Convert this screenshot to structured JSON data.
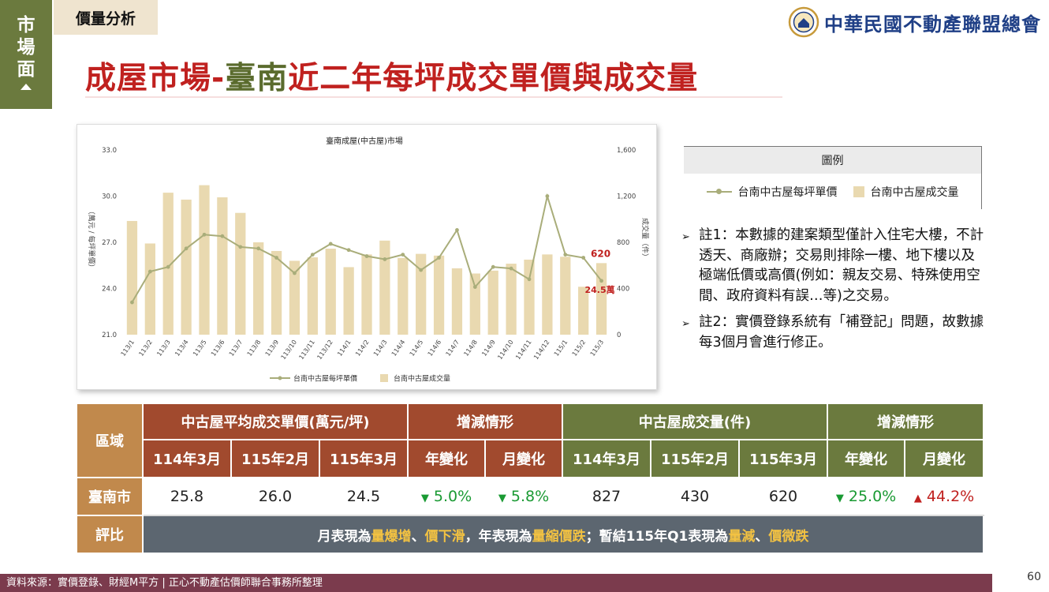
{
  "side_tab": {
    "chars": [
      "市",
      "場",
      "面"
    ]
  },
  "section_tag": "價量分析",
  "org_name": "中華民國不動產聯盟總會",
  "title": {
    "part1": "成屋市場-",
    "part2": "臺南",
    "part3": "近二年每坪成交單價與成交量"
  },
  "legend": {
    "header": "圖例",
    "line_label": "台南中古屋每坪單價",
    "bar_label": "台南中古屋成交量"
  },
  "notes": [
    "註1：本數據的建案類型僅計入住宅大樓，不計透天、商廠辦；交易則排除一樓、地下樓以及極端低價或高價(例如：親友交易、特殊使用空間、政府資料有誤…等)之交易。",
    "註2：實價登錄系統有「補登記」問題，故數據每3個月會進行修正。"
  ],
  "table": {
    "region_header": "區域",
    "price_header": "中古屋平均成交單價(萬元/坪)",
    "price_change_header": "增減情形",
    "volume_header": "中古屋成交量(件)",
    "volume_change_header": "增減情形",
    "period_cols": [
      "114年3月",
      "115年2月",
      "115年3月"
    ],
    "change_cols": [
      "年變化",
      "月變化"
    ],
    "row": {
      "region": "臺南市",
      "prices": [
        "25.8",
        "26.0",
        "24.5"
      ],
      "price_changes": [
        {
          "arrow": "▼",
          "value": "5.0%"
        },
        {
          "arrow": "▼",
          "value": "5.8%"
        }
      ],
      "volumes": [
        "827",
        "430",
        "620"
      ],
      "volume_changes": [
        {
          "arrow": "▼",
          "value": "25.0%"
        },
        {
          "arrow": "▲",
          "value": "44.2%"
        }
      ]
    },
    "summary_label": "評比",
    "summary": {
      "t1": "月表現為",
      "h1": "量爆增",
      "t2": "、",
      "h2": "價下滑",
      "t3": "，年表現為",
      "h3": "量縮價跌",
      "t4": "；暫結115年Q1表現為",
      "h4": "量減",
      "t5": "、",
      "h5": "價微跌"
    }
  },
  "footer": "資料來源：實價登錄、財經M平方 | 正心不動產估價師聯合事務所整理",
  "page_number": "60",
  "colors": {
    "bar": "#e9d9b0",
    "line": "#a9ad7a",
    "annotation": "#c0211f",
    "olive": "#6b7a3e",
    "brick": "#a14a2e",
    "tan": "#c1894c"
  },
  "chart_data": {
    "type": "bar",
    "title": "臺南成屋(中古屋)市場",
    "categories": [
      "113/1",
      "113/2",
      "113/3",
      "113/4",
      "113/5",
      "113/6",
      "113/7",
      "113/8",
      "113/9",
      "113/10",
      "113/11",
      "113/12",
      "114/1",
      "114/2",
      "114/3",
      "114/4",
      "114/5",
      "114/6",
      "114/7",
      "114/8",
      "114/9",
      "114/10",
      "114/11",
      "114/12",
      "115/1",
      "115/2",
      "115/3"
    ],
    "series": [
      {
        "name": "台南中古屋每坪單價",
        "kind": "line",
        "axis": "left",
        "values": [
          23.1,
          25.1,
          25.4,
          26.6,
          27.5,
          27.4,
          26.7,
          26.6,
          26.0,
          25.0,
          26.2,
          26.9,
          26.5,
          26.1,
          25.9,
          26.2,
          25.2,
          26.0,
          27.8,
          24.1,
          25.4,
          25.3,
          24.6,
          30.0,
          26.2,
          26.0,
          24.5
        ]
      },
      {
        "name": "台南中古屋成交量",
        "kind": "bar",
        "axis": "right",
        "values": [
          985,
          790,
          1230,
          1170,
          1295,
          1190,
          1055,
          800,
          725,
          640,
          670,
          745,
          585,
          695,
          815,
          665,
          700,
          685,
          575,
          530,
          555,
          615,
          650,
          695,
          675,
          415,
          620
        ]
      }
    ],
    "left_axis": {
      "label": "（萬元 / 每坪單價）",
      "ylim": [
        21.0,
        33.0
      ],
      "ticks": [
        "21.0",
        "24.0",
        "27.0",
        "30.0",
        "33.0"
      ]
    },
    "right_axis": {
      "label": "成交量（件）",
      "ylim": [
        0,
        1600
      ],
      "ticks": [
        "0",
        "400",
        "800",
        "1,200",
        "1,600"
      ]
    },
    "annotations": {
      "last_volume": "620",
      "last_price": "24.5萬"
    },
    "legend_position": "bottom",
    "grid": false
  }
}
